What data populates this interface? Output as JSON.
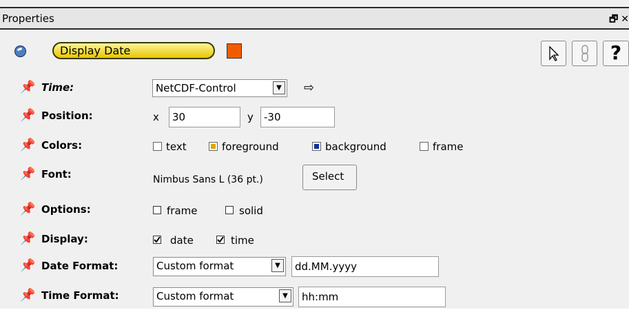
{
  "window": {
    "title": "Properties",
    "restore_icon": "restore-icon",
    "close_icon": "close-icon"
  },
  "header": {
    "object_name": "Display Date",
    "color": "#f25c00",
    "tools": [
      {
        "icon": "pointer-icon"
      },
      {
        "icon": "link-icon"
      },
      {
        "icon": "help-icon",
        "label": "?"
      }
    ]
  },
  "time": {
    "label": "Time:",
    "value": "NetCDF-Control",
    "go_icon": "arrow-right-icon"
  },
  "position": {
    "label": "Position:",
    "x_label": "x",
    "x": "30",
    "y_label": "y",
    "y": "-30"
  },
  "colors": {
    "label": "Colors:",
    "items": [
      {
        "name": "text",
        "color": "#ffffff"
      },
      {
        "name": "foreground",
        "color": "#e8a000"
      },
      {
        "name": "background",
        "color": "#1030a0"
      },
      {
        "name": "frame",
        "color": "#ffffff"
      }
    ]
  },
  "font": {
    "label": "Font:",
    "value": "Nimbus Sans L (36 pt.)",
    "button": "Select"
  },
  "options": {
    "label": "Options:",
    "frame": "frame",
    "frame_checked": false,
    "solid": "solid",
    "solid_checked": false
  },
  "display": {
    "label": "Display:",
    "date": "date",
    "date_checked": true,
    "time": "time",
    "time_checked": true
  },
  "date_format": {
    "label": "Date Format:",
    "mode": "Custom format",
    "pattern": "dd.MM.yyyy"
  },
  "time_format": {
    "label": "Time Format:",
    "mode": "Custom format",
    "pattern": "hh:mm"
  }
}
